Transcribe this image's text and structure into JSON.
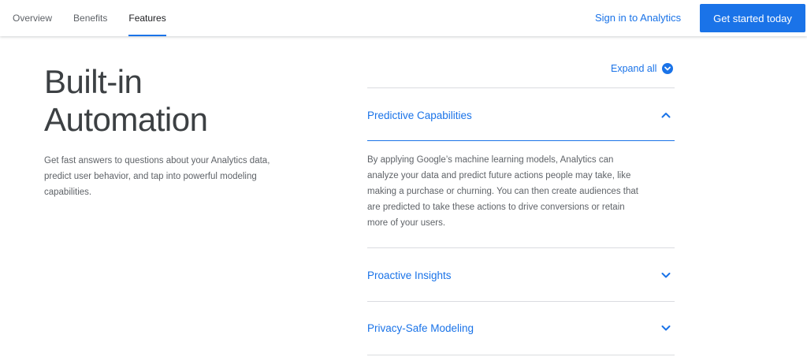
{
  "nav": {
    "tabs": [
      {
        "label": "Overview"
      },
      {
        "label": "Benefits"
      },
      {
        "label": "Features"
      }
    ],
    "active_tab": "Features",
    "signin_label": "Sign in to Analytics",
    "cta_label": "Get started today"
  },
  "hero": {
    "title_line1": "Built-in",
    "title_line2": "Automation",
    "description": "Get fast answers to questions about your Analytics data, predict user behavior, and tap into powerful modeling capabilities."
  },
  "accordion": {
    "expand_all_label": "Expand all",
    "items": [
      {
        "title": "Predictive Capabilities",
        "expanded": true,
        "body": "By applying Google’s machine learning models, Analytics can analyze your data and predict future actions people may take, like making a purchase or churning. You can then create audiences that are predicted to take these actions to drive conversions or retain more of your users."
      },
      {
        "title": "Proactive Insights",
        "expanded": false
      },
      {
        "title": "Privacy-Safe Modeling",
        "expanded": false
      }
    ]
  },
  "colors": {
    "accent": "#1a73e8",
    "text": "#3c4043",
    "muted": "#5f6368",
    "divider": "#dadce0"
  }
}
